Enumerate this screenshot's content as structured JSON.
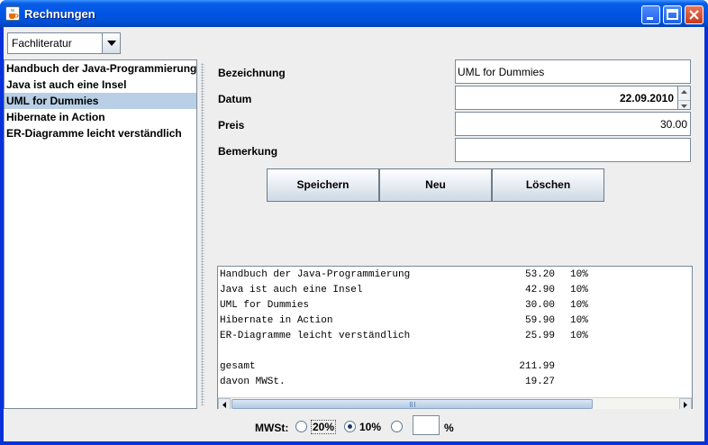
{
  "window": {
    "title": "Rechnungen",
    "icon": "java-cup-icon",
    "controls": [
      "minimize-icon",
      "maximize-icon",
      "close-icon"
    ]
  },
  "category": {
    "selected": "Fachliteratur"
  },
  "books": {
    "items": [
      "Handbuch der Java-Programmierung",
      "Java ist auch eine Insel",
      "UML for Dummies",
      "Hibernate in Action",
      "ER-Diagramme leicht verständlich"
    ],
    "selected_index": 2
  },
  "form": {
    "bezeichnung_label": "Bezeichnung",
    "bezeichnung_value": "UML for Dummies",
    "datum_label": "Datum",
    "datum_value": "22.09.2010",
    "preis_label": "Preis",
    "preis_value": "30.00",
    "bemerkung_label": "Bemerkung",
    "bemerkung_value": ""
  },
  "buttons": {
    "save": "Speichern",
    "new": "Neu",
    "delete": "Löschen"
  },
  "summary": {
    "rows": [
      {
        "name": "Handbuch der Java-Programmierung",
        "amount": "53.20",
        "rate": "10%"
      },
      {
        "name": "Java ist auch eine Insel",
        "amount": "42.90",
        "rate": "10%"
      },
      {
        "name": "UML for Dummies",
        "amount": "30.00",
        "rate": "10%"
      },
      {
        "name": "Hibernate in Action",
        "amount": "59.90",
        "rate": "10%"
      },
      {
        "name": "ER-Diagramme leicht verständlich",
        "amount": "25.99",
        "rate": "10%"
      }
    ],
    "total_label": "gesamt",
    "total_value": "211.99",
    "tax_label": "davon MWSt.",
    "tax_value": "19.27"
  },
  "mwst": {
    "label": "MWSt:",
    "option_20": "20%",
    "option_10": "10%",
    "selected": "10%",
    "custom_value": "",
    "custom_unit": "%"
  },
  "colors": {
    "selection": "#b8cfe5",
    "titlebar": "#0055e5",
    "background": "#eeeeee"
  }
}
